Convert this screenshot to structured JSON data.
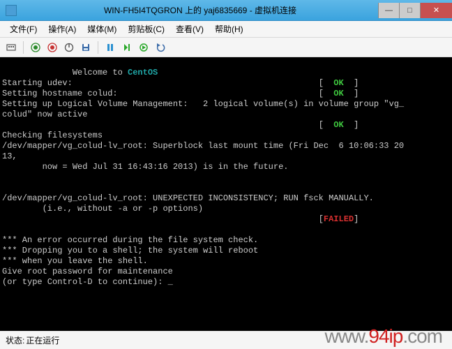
{
  "titlebar": {
    "text": "WIN-FH5I4TQGRON 上的 yaj6835669 - 虚拟机连接",
    "min": "—",
    "max": "□",
    "close": "✕"
  },
  "menu": {
    "file": "文件(F)",
    "action": "操作(A)",
    "media": "媒体(M)",
    "clipboard": "剪贴板(C)",
    "view": "查看(V)",
    "help": "帮助(H)"
  },
  "console": {
    "welcome_pre": "              Welcome to ",
    "welcome_os": "CentOS",
    "l_udev": "Starting udev:",
    "l_hostname": "Setting hostname colud:",
    "bracket_l": "[",
    "bracket_r": "]",
    "ok": "  OK  ",
    "failed": "FAILED",
    "l_lvm_a": "Setting up Logical Volume Management:   2 logical volume(s) in volume group \"vg_",
    "l_lvm_b": "colud\" now active",
    "l_chk": "Checking filesystems",
    "l_sb_a": "/dev/mapper/vg_colud-lv_root: Superblock last mount time (Fri Dec  6 10:06:33 20",
    "l_sb_b": "13,",
    "l_sb_c": "        now = Wed Jul 31 16:43:16 2013) is in the future.",
    "l_unexp": "/dev/mapper/vg_colud-lv_root: UNEXPECTED INCONSISTENCY; RUN fsck MANUALLY.",
    "l_ie": "        (i.e., without -a or -p options)",
    "l_err1": "*** An error occurred during the file system check.",
    "l_err2": "*** Dropping you to a shell; the system will reboot",
    "l_err3": "*** when you leave the shell.",
    "l_pw": "Give root password for maintenance",
    "l_ctrl": "(or type Control-D to continue):",
    "cursor": "_"
  },
  "status": {
    "label": "状态:",
    "value": "正在运行"
  },
  "watermark": {
    "p1": "www.",
    "p2": "94ip",
    "p3": ".com"
  }
}
